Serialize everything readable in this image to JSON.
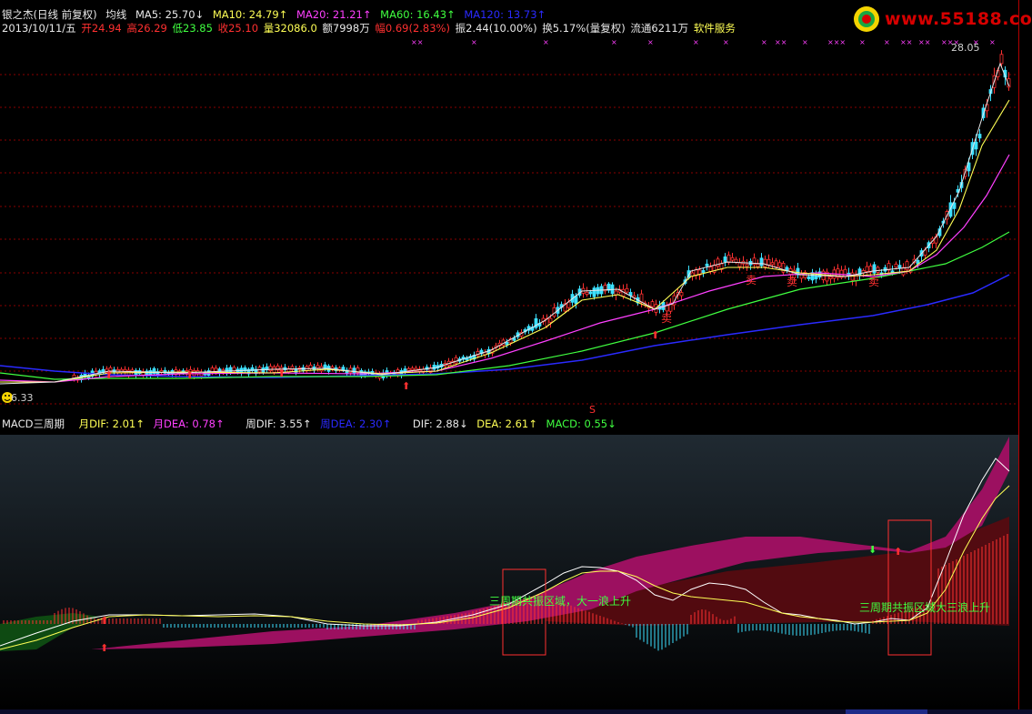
{
  "header": {
    "stock_name": "银之杰(日线 前复权)",
    "indicator_label": "均线",
    "ma5": "MA5: 25.70↓",
    "ma10": "MA10: 24.79↑",
    "ma20": "MA20: 21.21↑",
    "ma60": "MA60: 16.43↑",
    "ma120": "MA120: 13.73↑"
  },
  "quote": {
    "date": "2013/10/11/五",
    "open": "开24.94",
    "high": "高26.29",
    "low": "低23.85",
    "close": "收25.10",
    "volume": "量32086.0",
    "amount": "额7998万",
    "change": "幅0.69(2.83%)",
    "amplitude": "振2.44(10.00%)",
    "turnover": "换5.17%(量复权)",
    "float_shares": "流通6211万",
    "software": "软件服务"
  },
  "logo": {
    "text": "www.55188.com"
  },
  "price_axis": {
    "max_label": "28.05",
    "min_label": "6.33"
  },
  "signals": {
    "sell_label": "卖",
    "s_label": "S"
  },
  "macd_header": {
    "title": "MACD三周期",
    "month_dif": "月DIF: 2.01↑",
    "month_dea": "月DEA: 0.78↑",
    "week_dif": "周DIF: 3.55↑",
    "week_dea": "周DEA: 2.30↑",
    "dif": "DIF: 2.88↓",
    "dea": "DEA: 2.61↑",
    "macd": "MACD: 0.55↓"
  },
  "annotations": {
    "zone1": "三周期共振区域，大一浪上升",
    "zone2": "三周期共振区域大三浪上升"
  },
  "colors": {
    "up": "#ff3030",
    "down": "#3ce0ff",
    "ma5": "#e8e8e8",
    "ma10": "#ffff55",
    "ma20": "#ff40ff",
    "ma60": "#40ff40",
    "ma120": "#2a2aff",
    "grid": "#8a0000"
  }
}
